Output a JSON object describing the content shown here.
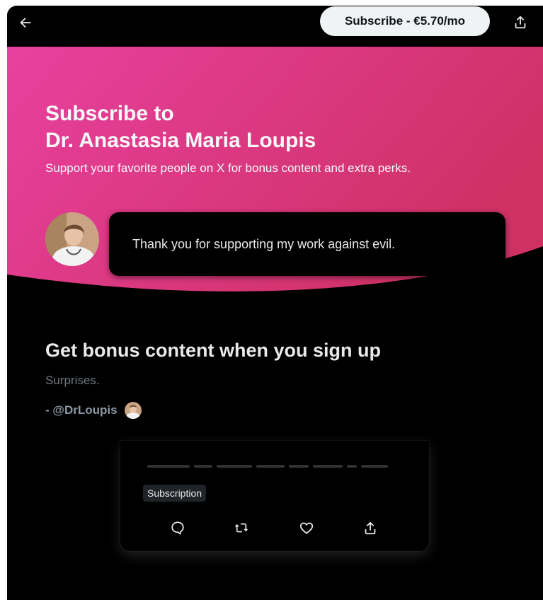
{
  "header": {
    "back_icon": "arrow-left-icon",
    "subscribe_label": "Subscribe - €5.70/mo",
    "share_icon": "share-icon"
  },
  "hero": {
    "title_line1": "Subscribe to",
    "title_line2": "Dr. Anastasia Maria Loupis",
    "subtitle": "Support your favorite people on X for bonus content and extra perks.",
    "message": "Thank you for supporting my work against evil.",
    "gradient_start": "#e8409f",
    "gradient_end": "#cf3165"
  },
  "bonus": {
    "title": "Get bonus content when you sign up",
    "description": "Surprises.",
    "author_handle": "- @DrLoupis"
  },
  "preview": {
    "tag_label": "Subscription",
    "actions": [
      {
        "icon": "reply-icon"
      },
      {
        "icon": "repost-icon"
      },
      {
        "icon": "like-icon"
      },
      {
        "icon": "share-icon"
      }
    ]
  },
  "colors": {
    "background": "#000000",
    "pill_bg": "#eff3f4",
    "muted_text": "#71767b"
  }
}
